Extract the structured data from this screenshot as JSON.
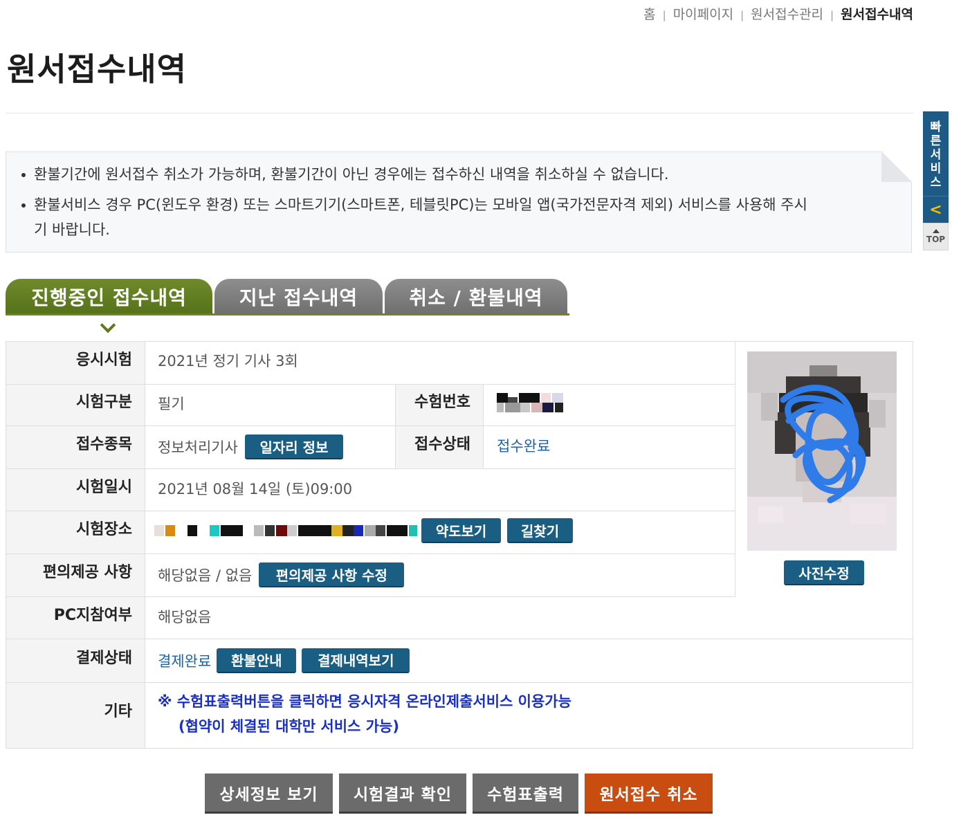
{
  "breadcrumb": {
    "items": [
      "홈",
      "마이페이지",
      "원서접수관리"
    ],
    "current": "원서접수내역"
  },
  "page": {
    "title": "원서접수내역"
  },
  "notice": {
    "lines": [
      "환불기간에 원서접수 취소가 가능하며, 환불기간이 아닌 경우에는 접수하신 내역을 취소하실 수 없습니다.",
      "환불서비스 경우 PC(윈도우 환경) 또는 스마트기기(스마트폰, 테블릿PC)는 모바일 앱(국가전문자격 제외) 서비스를 사용해 주시기 바랍니다."
    ]
  },
  "quick_menu": {
    "label_chars": [
      "빠",
      "른",
      "서",
      "비",
      "스"
    ],
    "arrow": "<",
    "top_label": "TOP"
  },
  "tabs": [
    {
      "label": "진행중인 접수내역",
      "active": true
    },
    {
      "label": "지난 접수내역",
      "active": false
    },
    {
      "label": "취소 / 환불내역",
      "active": false
    }
  ],
  "info": {
    "exam_label": "응시시험",
    "exam_value": "2021년 정기 기사 3회",
    "type_label": "시험구분",
    "type_value": "필기",
    "number_label": "수험번호",
    "subject_label": "접수종목",
    "subject_value": "정보처리기사",
    "job_info_button": "일자리 정보",
    "status_label": "접수상태",
    "status_value": "접수완료",
    "date_label": "시험일시",
    "date_value": "2021년 08월 14일 (토)09:00",
    "place_label": "시험장소",
    "map_button": "약도보기",
    "directions_button": "길찾기",
    "convenience_label": "편의제공 사항",
    "convenience_value": "해당없음 / 없음",
    "convenience_edit_button": "편의제공 사항 수정",
    "pc_label": "PC지참여부",
    "pc_value": "해당없음",
    "payment_label": "결제상태",
    "payment_value": "결제완료",
    "refund_button": "환불안내",
    "payment_history_button": "결제내역보기",
    "etc_label": "기타",
    "etc_line1": "※ 수험표출력버튼을 클릭하면 응시자격 온라인제출서비스 이용가능",
    "etc_line2": "(협약이 체결된 대학만 서비스 가능)",
    "photo_edit_button": "사진수정"
  },
  "actions": {
    "detail": "상세정보 보기",
    "result": "시험결과 확인",
    "ticket": "수험표출력",
    "cancel": "원서접수 취소"
  },
  "colors": {
    "tab_active": "#5f7b21",
    "tab_inactive": "#7d7d7d",
    "button_blue": "#1a5f83",
    "cancel_orange": "#c94c11",
    "quick_blue": "#1d5a86"
  }
}
